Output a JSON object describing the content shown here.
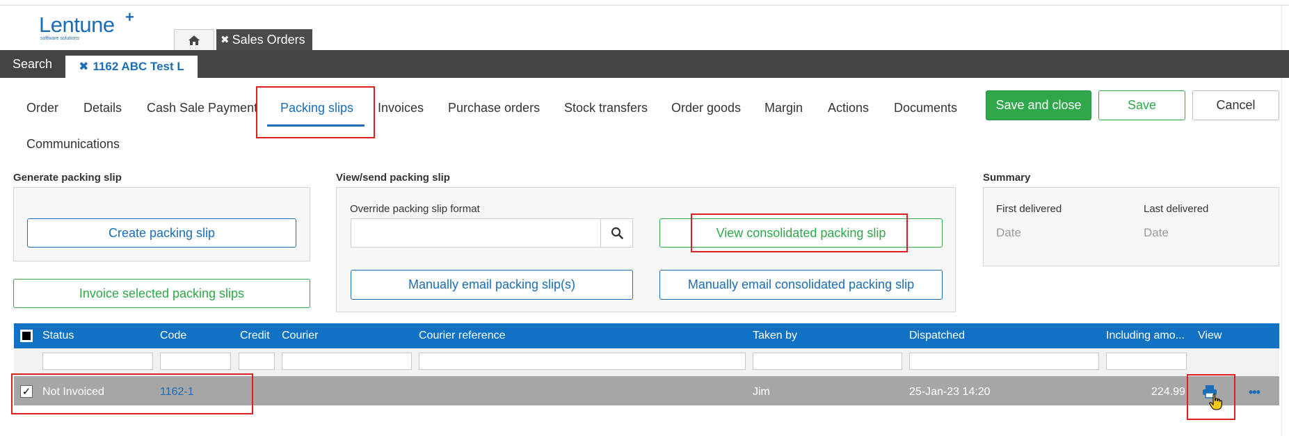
{
  "logo": {
    "name": "Lentune",
    "plus": "+",
    "tagline": "software solutions"
  },
  "app_tabs": {
    "sales_orders": "Sales Orders",
    "close_glyph": "✖"
  },
  "record_bar": {
    "search": "Search",
    "record": "1162 ABC Test L",
    "close_glyph": "✖"
  },
  "page_tabs": [
    "Order",
    "Details",
    "Cash Sale Payment",
    "Packing slips",
    "Invoices",
    "Purchase orders",
    "Stock transfers",
    "Order goods",
    "Margin",
    "Actions",
    "Documents",
    "Communications"
  ],
  "active_tab": "Packing slips",
  "actions": {
    "save_close": "Save and close",
    "save": "Save",
    "cancel": "Cancel"
  },
  "generate": {
    "label": "Generate packing slip",
    "create": "Create packing slip",
    "invoice_selected": "Invoice selected packing slips"
  },
  "view_send": {
    "label": "View/send packing slip",
    "override_label": "Override packing slip format",
    "override_value": "",
    "view_consolidated": "View consolidated packing slip",
    "email_manual": "Manually email packing slip(s)",
    "email_consolidated": "Manually email consolidated packing slip"
  },
  "summary": {
    "label": "Summary",
    "first_delivered_label": "First delivered",
    "first_delivered_value": "Date",
    "last_delivered_label": "Last delivered",
    "last_delivered_value": "Date"
  },
  "grid": {
    "columns": [
      "Status",
      "Code",
      "Credit",
      "Courier",
      "Courier reference",
      "Taken by",
      "Dispatched",
      "Including amo...",
      "View"
    ],
    "rows": [
      {
        "checked": true,
        "status": "Not Invoiced",
        "code": "1162-1",
        "credit": "",
        "courier": "",
        "courier_reference": "",
        "taken_by": "Jim",
        "dispatched": "25-Jan-23 14:20",
        "including_amount": "224.99"
      }
    ]
  },
  "colors": {
    "brand_blue": "#1b6db5",
    "header_blue": "#1172c4",
    "green": "#2ea84a",
    "dark_bar": "#444444",
    "highlight_red": "#e02020"
  }
}
